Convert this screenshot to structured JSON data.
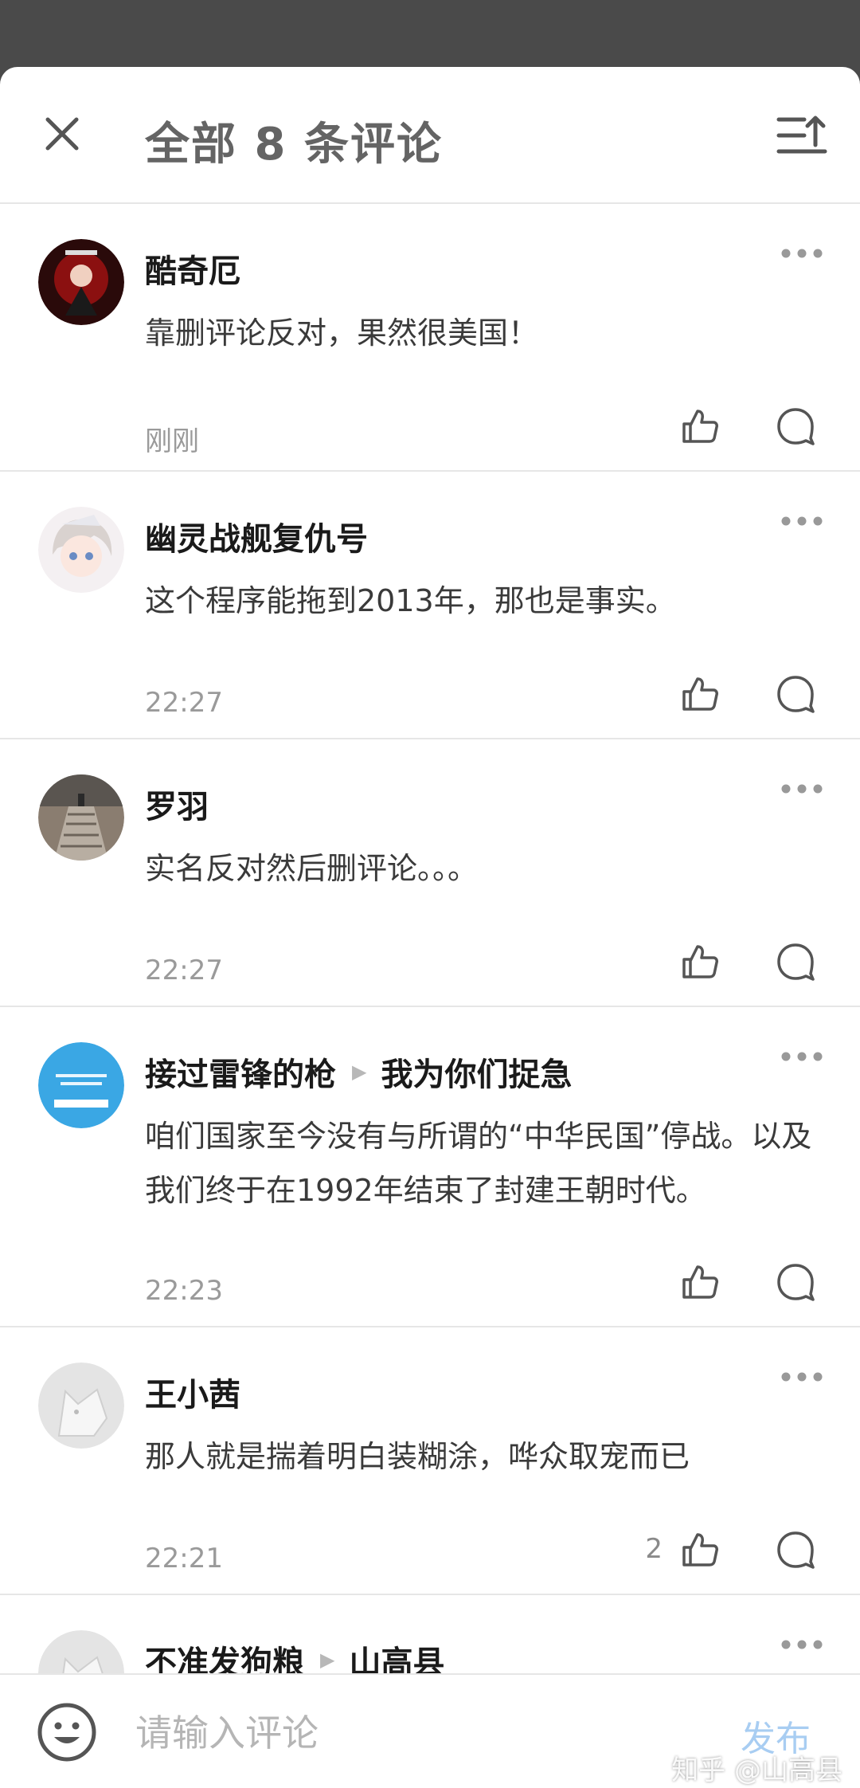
{
  "header": {
    "title": "全部 8 条评论"
  },
  "comments": [
    {
      "author": "酷奇厄",
      "reply_to": "",
      "content": "靠删评论反对，果然很美国！",
      "time": "刚刚",
      "likes": ""
    },
    {
      "author": "幽灵战舰复仇号",
      "reply_to": "",
      "content": "这个程序能拖到2013年，那也是事实。",
      "time": "22:27",
      "likes": ""
    },
    {
      "author": "罗羽",
      "reply_to": "",
      "content": "实名反对然后删评论。。。",
      "time": "22:27",
      "likes": ""
    },
    {
      "author": "接过雷锋的枪",
      "reply_to": "我为你们捉急",
      "content": "咱们国家至今没有与所谓的“中华民国”停战。以及我们终于在1992年结束了封建王朝时代。",
      "time": "22:23",
      "likes": ""
    },
    {
      "author": "王小茜",
      "reply_to": "",
      "content": "那人就是揣着明白装糊涂，哗众取宠而已",
      "time": "22:21",
      "likes": "2"
    },
    {
      "author": "不准发狗粮",
      "reply_to": "山高县",
      "content": "",
      "time": "",
      "likes": ""
    }
  ],
  "footer": {
    "input_placeholder": "请输入评论",
    "publish_label": "发布",
    "watermark": "知乎 @山高县"
  },
  "colors": {
    "accent": "#a8cdf2",
    "avatar_blue": "#3aa7e4"
  }
}
